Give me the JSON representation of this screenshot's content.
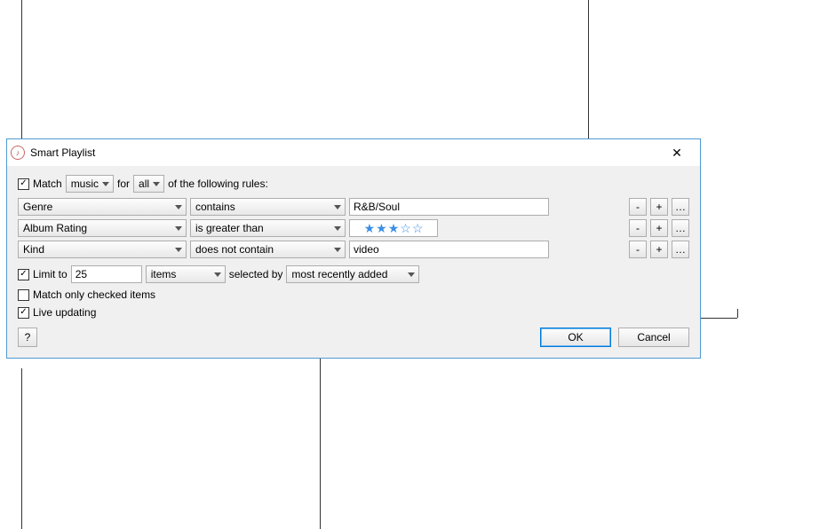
{
  "window": {
    "title": "Smart Playlist",
    "close_label": "✕"
  },
  "match": {
    "checked": true,
    "prefix": "Match",
    "media": "music",
    "for_label": "for",
    "scope": "all",
    "suffix": "of the following rules:"
  },
  "rules": [
    {
      "field": "Genre",
      "op": "contains",
      "value": "R&B/Soul",
      "stars": null
    },
    {
      "field": "Album Rating",
      "op": "is greater than",
      "value": null,
      "stars": 3
    },
    {
      "field": "Kind",
      "op": "does not contain",
      "value": "video",
      "stars": null
    }
  ],
  "rule_buttons": {
    "remove": "-",
    "add": "+",
    "more": "…"
  },
  "limit": {
    "checked": true,
    "prefix": "Limit to",
    "value": "25",
    "unit": "items",
    "selected_by_label": "selected by",
    "order": "most recently added"
  },
  "only_checked": {
    "checked": false,
    "label": "Match only checked items"
  },
  "live_updating": {
    "checked": true,
    "label": "Live updating"
  },
  "footer": {
    "help": "?",
    "ok": "OK",
    "cancel": "Cancel"
  }
}
